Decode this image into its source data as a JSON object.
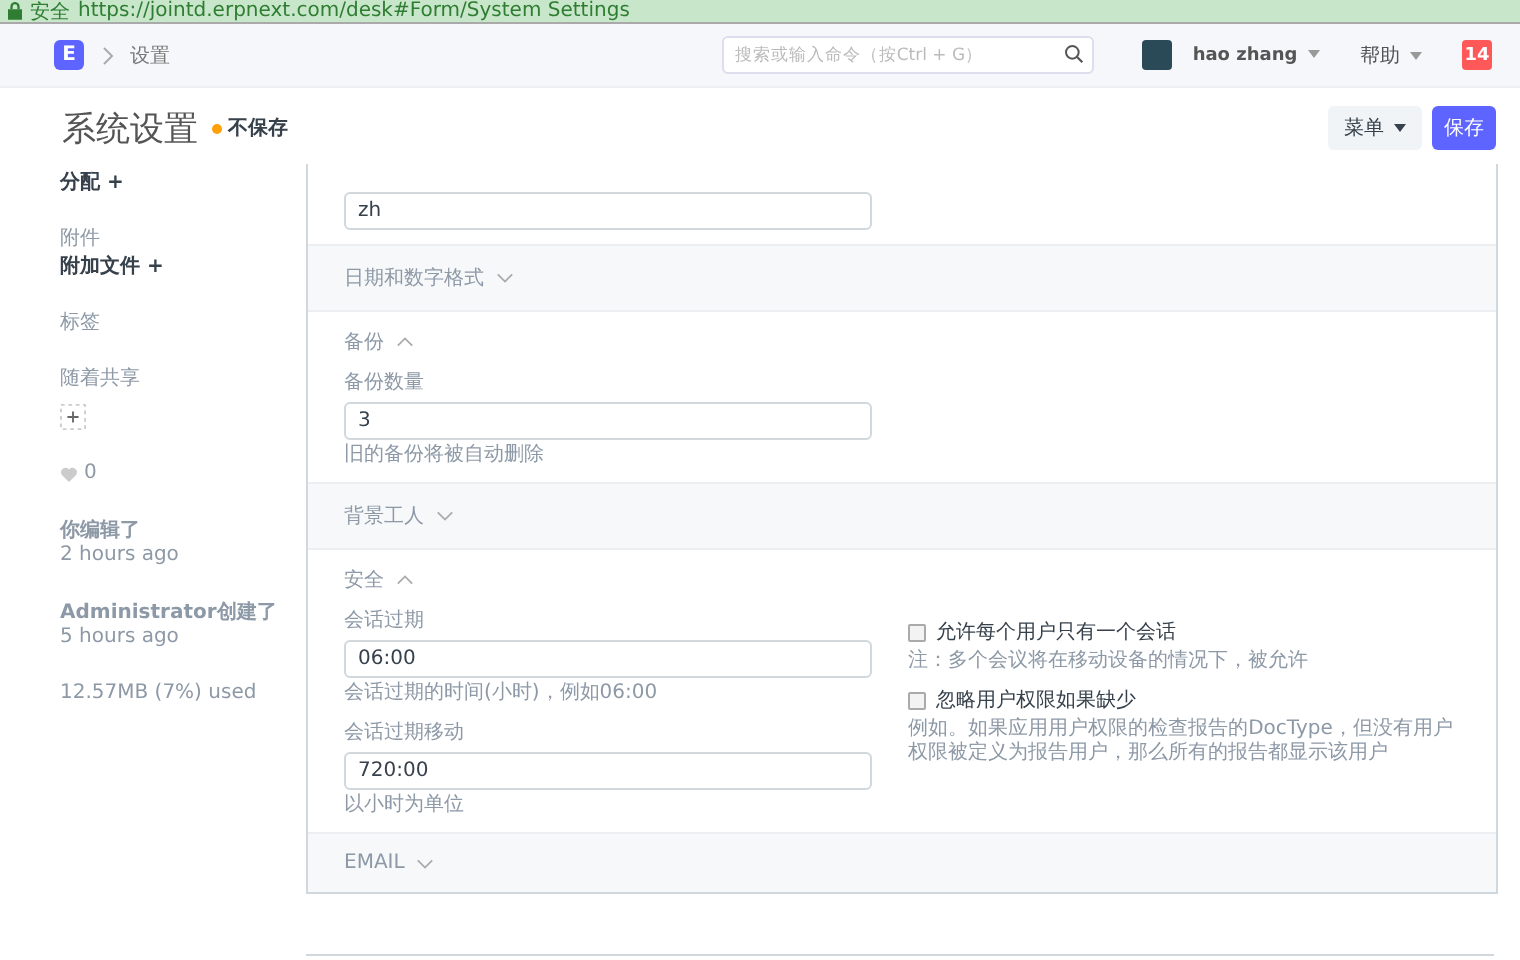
{
  "address_bar": {
    "secure_label": "安全",
    "url": "https://jointd.erpnext.com/desk#Form/System Settings"
  },
  "navbar": {
    "logo": "E",
    "breadcrumb": "设置",
    "search": {
      "placeholder": "搜索或输入命令（按Ctrl + G）"
    },
    "user": "hao zhang",
    "help": "帮助",
    "notifications": "14"
  },
  "page_head": {
    "title": "系统设置",
    "status": "不保存",
    "menu_button": "菜单",
    "save_button": "保存"
  },
  "sidebar": {
    "assign": "分配 +",
    "attachments_label": "附件",
    "attach_file": "附加文件 +",
    "tags_label": "标签",
    "shared_label": "随着共享",
    "likes": "0",
    "activity": [
      {
        "text": "你编辑了",
        "time": "2 hours ago"
      },
      {
        "text": "Administrator创建了",
        "time": "5 hours ago"
      }
    ],
    "usage": "12.57MB (7%) used"
  },
  "sections": [
    {
      "kind": "fields",
      "left": [
        {
          "value": "zh"
        }
      ]
    },
    {
      "kind": "section",
      "title": "日期和数字格式",
      "expanded": false
    },
    {
      "kind": "section",
      "title": "备份",
      "expanded": true,
      "left": [
        {
          "label": "备份数量",
          "value": "3",
          "description": "旧的备份将被自动删除"
        }
      ]
    },
    {
      "kind": "section",
      "title": "背景工人",
      "expanded": false
    },
    {
      "kind": "section",
      "title": "安全",
      "expanded": true,
      "left": [
        {
          "label": "会话过期",
          "value": "06:00",
          "description": "会话过期的时间(小时)，例如06:00"
        },
        {
          "label": "会话过期移动",
          "value": "720:00",
          "description": "以小时为单位"
        }
      ],
      "right": [
        {
          "label": "允许每个用户只有一个会话",
          "checked": false,
          "description": "注：多个会议将在移动设备的情况下，被允许"
        },
        {
          "label": "忽略用户权限如果缺少",
          "checked": false,
          "description": "例如。如果应用用户权限的检查报告的DocType，但没有用户权限被定义为报告用户，那么所有的报告都显示该用户"
        }
      ]
    },
    {
      "kind": "section",
      "title": "EMAIL",
      "expanded": false
    }
  ]
}
